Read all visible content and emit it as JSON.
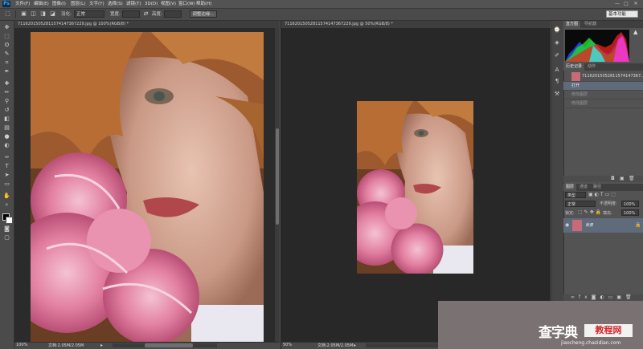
{
  "app": {
    "logo": "Ps"
  },
  "menu": [
    "文件(F)",
    "编辑(E)",
    "图像(I)",
    "图层(L)",
    "文字(Y)",
    "选择(S)",
    "滤镜(T)",
    "3D(D)",
    "视图(V)",
    "窗口(W)",
    "帮助(H)"
  ],
  "window_controls": {
    "min": "—",
    "max": "□",
    "close": "✕"
  },
  "options_bar": {
    "feather_label": "羽化:",
    "feather_value": "正常",
    "width_label": "宽度:",
    "height_label": "高度:",
    "refine_edge": "调整边缘...",
    "workspace": "基本功能"
  },
  "documents": [
    {
      "tab_title": "71162015052811574147367229.jpg @ 100%(RGB/8) *",
      "zoom": "100%",
      "status": "文档:2.05M/2.05M"
    },
    {
      "tab_title": "71162015052811574147367229.jpg @ 50%(RGB/8) *",
      "zoom": "50%",
      "status": "文档:2.05M/2.05M"
    }
  ],
  "panels": {
    "histogram_tabs": [
      "直方图",
      "导航器"
    ],
    "history_tabs": [
      "历史记录",
      "动作"
    ],
    "history_snapshot": "71162015052811574147367...",
    "history_items": [
      "打开",
      "修改图层",
      "修改图层"
    ],
    "layers_tabs": [
      "图层",
      "通道",
      "路径"
    ],
    "layers_kind": "类型",
    "layers_blend": "正常",
    "layers_opacity_label": "不透明度:",
    "layers_opacity": "100%",
    "layers_lock_label": "锁定:",
    "layers_fill_label": "填充:",
    "layers_fill": "100%",
    "layer_name": "背景"
  },
  "watermark": {
    "title": "查字典",
    "sub1": "教程网",
    "url": "jiaocheng.chazidian.com"
  }
}
